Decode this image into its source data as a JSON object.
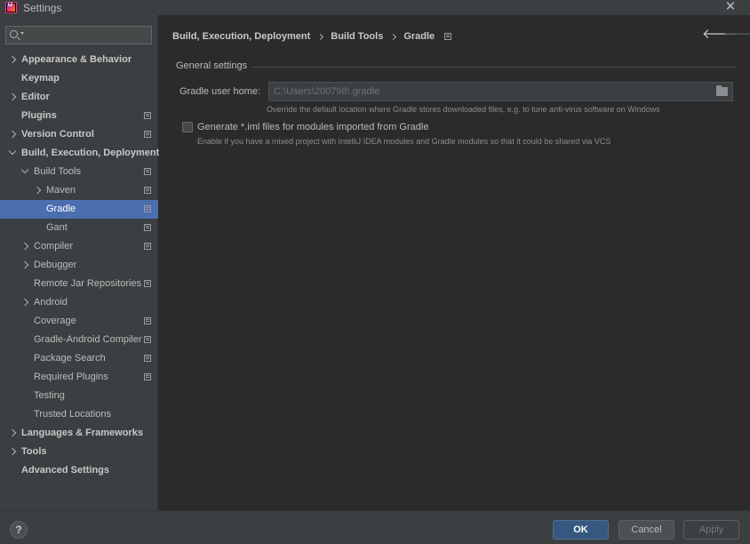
{
  "window": {
    "title": "Settings",
    "close_glyph": "✕"
  },
  "search": {
    "placeholder": "",
    "value": ""
  },
  "sidebar": {
    "items": [
      {
        "label": "Appearance & Behavior",
        "bold": true,
        "chevron": "right",
        "level": 0,
        "page_icon": false
      },
      {
        "label": "Keymap",
        "bold": true,
        "chevron": "none",
        "level": 0,
        "page_icon": false
      },
      {
        "label": "Editor",
        "bold": true,
        "chevron": "right",
        "level": 0,
        "page_icon": false
      },
      {
        "label": "Plugins",
        "bold": true,
        "chevron": "none",
        "level": 0,
        "page_icon": true
      },
      {
        "label": "Version Control",
        "bold": true,
        "chevron": "right",
        "level": 0,
        "page_icon": true
      },
      {
        "label": "Build, Execution, Deployment",
        "bold": true,
        "chevron": "down",
        "level": 0,
        "page_icon": false
      },
      {
        "label": "Build Tools",
        "bold": false,
        "chevron": "down",
        "level": 1,
        "page_icon": true
      },
      {
        "label": "Maven",
        "bold": false,
        "chevron": "right",
        "level": 2,
        "page_icon": true
      },
      {
        "label": "Gradle",
        "bold": false,
        "chevron": "none",
        "level": 2,
        "page_icon": true,
        "selected": true
      },
      {
        "label": "Gant",
        "bold": false,
        "chevron": "none",
        "level": 2,
        "page_icon": true
      },
      {
        "label": "Compiler",
        "bold": false,
        "chevron": "right",
        "level": 1,
        "page_icon": true
      },
      {
        "label": "Debugger",
        "bold": false,
        "chevron": "right",
        "level": 1,
        "page_icon": false
      },
      {
        "label": "Remote Jar Repositories",
        "bold": false,
        "chevron": "none",
        "level": 1,
        "page_icon": true
      },
      {
        "label": "Android",
        "bold": false,
        "chevron": "right",
        "level": 1,
        "page_icon": false
      },
      {
        "label": "Coverage",
        "bold": false,
        "chevron": "none",
        "level": 1,
        "page_icon": true
      },
      {
        "label": "Gradle-Android Compiler",
        "bold": false,
        "chevron": "none",
        "level": 1,
        "page_icon": true
      },
      {
        "label": "Package Search",
        "bold": false,
        "chevron": "none",
        "level": 1,
        "page_icon": true
      },
      {
        "label": "Required Plugins",
        "bold": false,
        "chevron": "none",
        "level": 1,
        "page_icon": true
      },
      {
        "label": "Testing",
        "bold": false,
        "chevron": "none",
        "level": 1,
        "page_icon": false
      },
      {
        "label": "Trusted Locations",
        "bold": false,
        "chevron": "none",
        "level": 1,
        "page_icon": false
      },
      {
        "label": "Languages & Frameworks",
        "bold": true,
        "chevron": "right",
        "level": 0,
        "page_icon": false
      },
      {
        "label": "Tools",
        "bold": true,
        "chevron": "right",
        "level": 0,
        "page_icon": false
      },
      {
        "label": "Advanced Settings",
        "bold": true,
        "chevron": "none",
        "level": 0,
        "page_icon": false
      }
    ]
  },
  "breadcrumb": [
    "Build, Execution, Deployment",
    "Build Tools",
    "Gradle"
  ],
  "nav": {
    "back_glyph": "🡐",
    "forward_glyph": "🡒"
  },
  "general": {
    "section_title": "General settings",
    "user_home_label": "Gradle user home:",
    "user_home_value": "C:\\Users\\200798\\.gradle",
    "user_home_help": "Override the default location where Gradle stores downloaded files, e.g. to tune anti-virus software on Windows",
    "iml_checkbox_label": "Generate *.iml files for modules imported from Gradle",
    "iml_checkbox_checked": false,
    "iml_help": "Enable if you have a mixed project with IntelliJ IDEA modules and Gradle modules so that it could be shared via VCS"
  },
  "footer": {
    "help_label": "?",
    "ok_label": "OK",
    "cancel_label": "Cancel",
    "apply_label": "Apply"
  },
  "colors": {
    "selection": "#4b6eaf",
    "ok_button": "#365880",
    "sidebar_bg": "#3c3f41",
    "main_bg": "#2b2b2b"
  }
}
